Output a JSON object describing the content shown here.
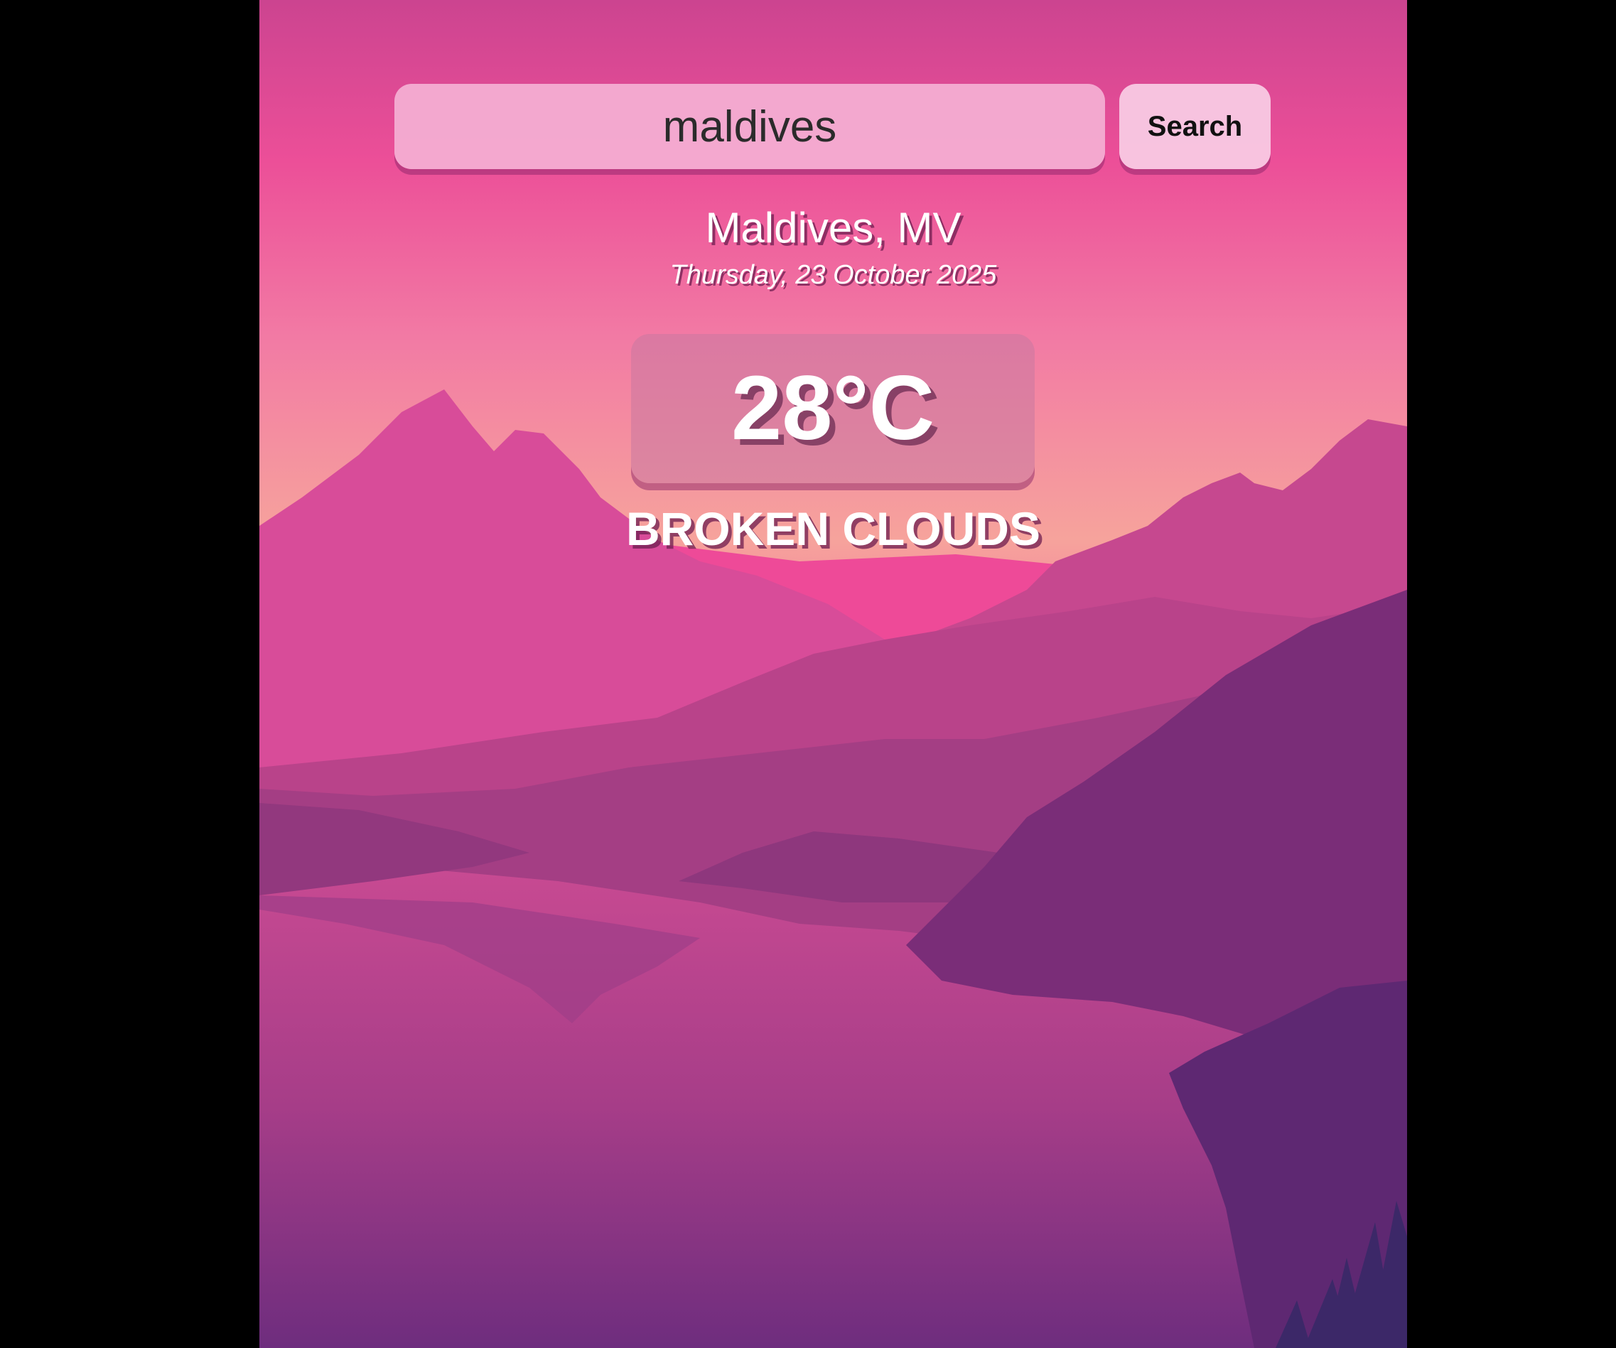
{
  "search": {
    "value": "maldives",
    "button_label": "Search"
  },
  "weather": {
    "location": "Maldives, MV",
    "date": "Thursday, 23 October 2025",
    "temperature": "28°C",
    "condition": "BROKEN CLOUDS"
  },
  "colors": {
    "sky_top": "#d0448f",
    "sky_mid": "#f06aa0",
    "sky_horizon": "#f6a8a0",
    "mountain_far": "#da4e98",
    "mountain_mid": "#a9407e",
    "mountain_dark": "#7e2d78",
    "water": "#b2468c",
    "frame": "#000000"
  }
}
